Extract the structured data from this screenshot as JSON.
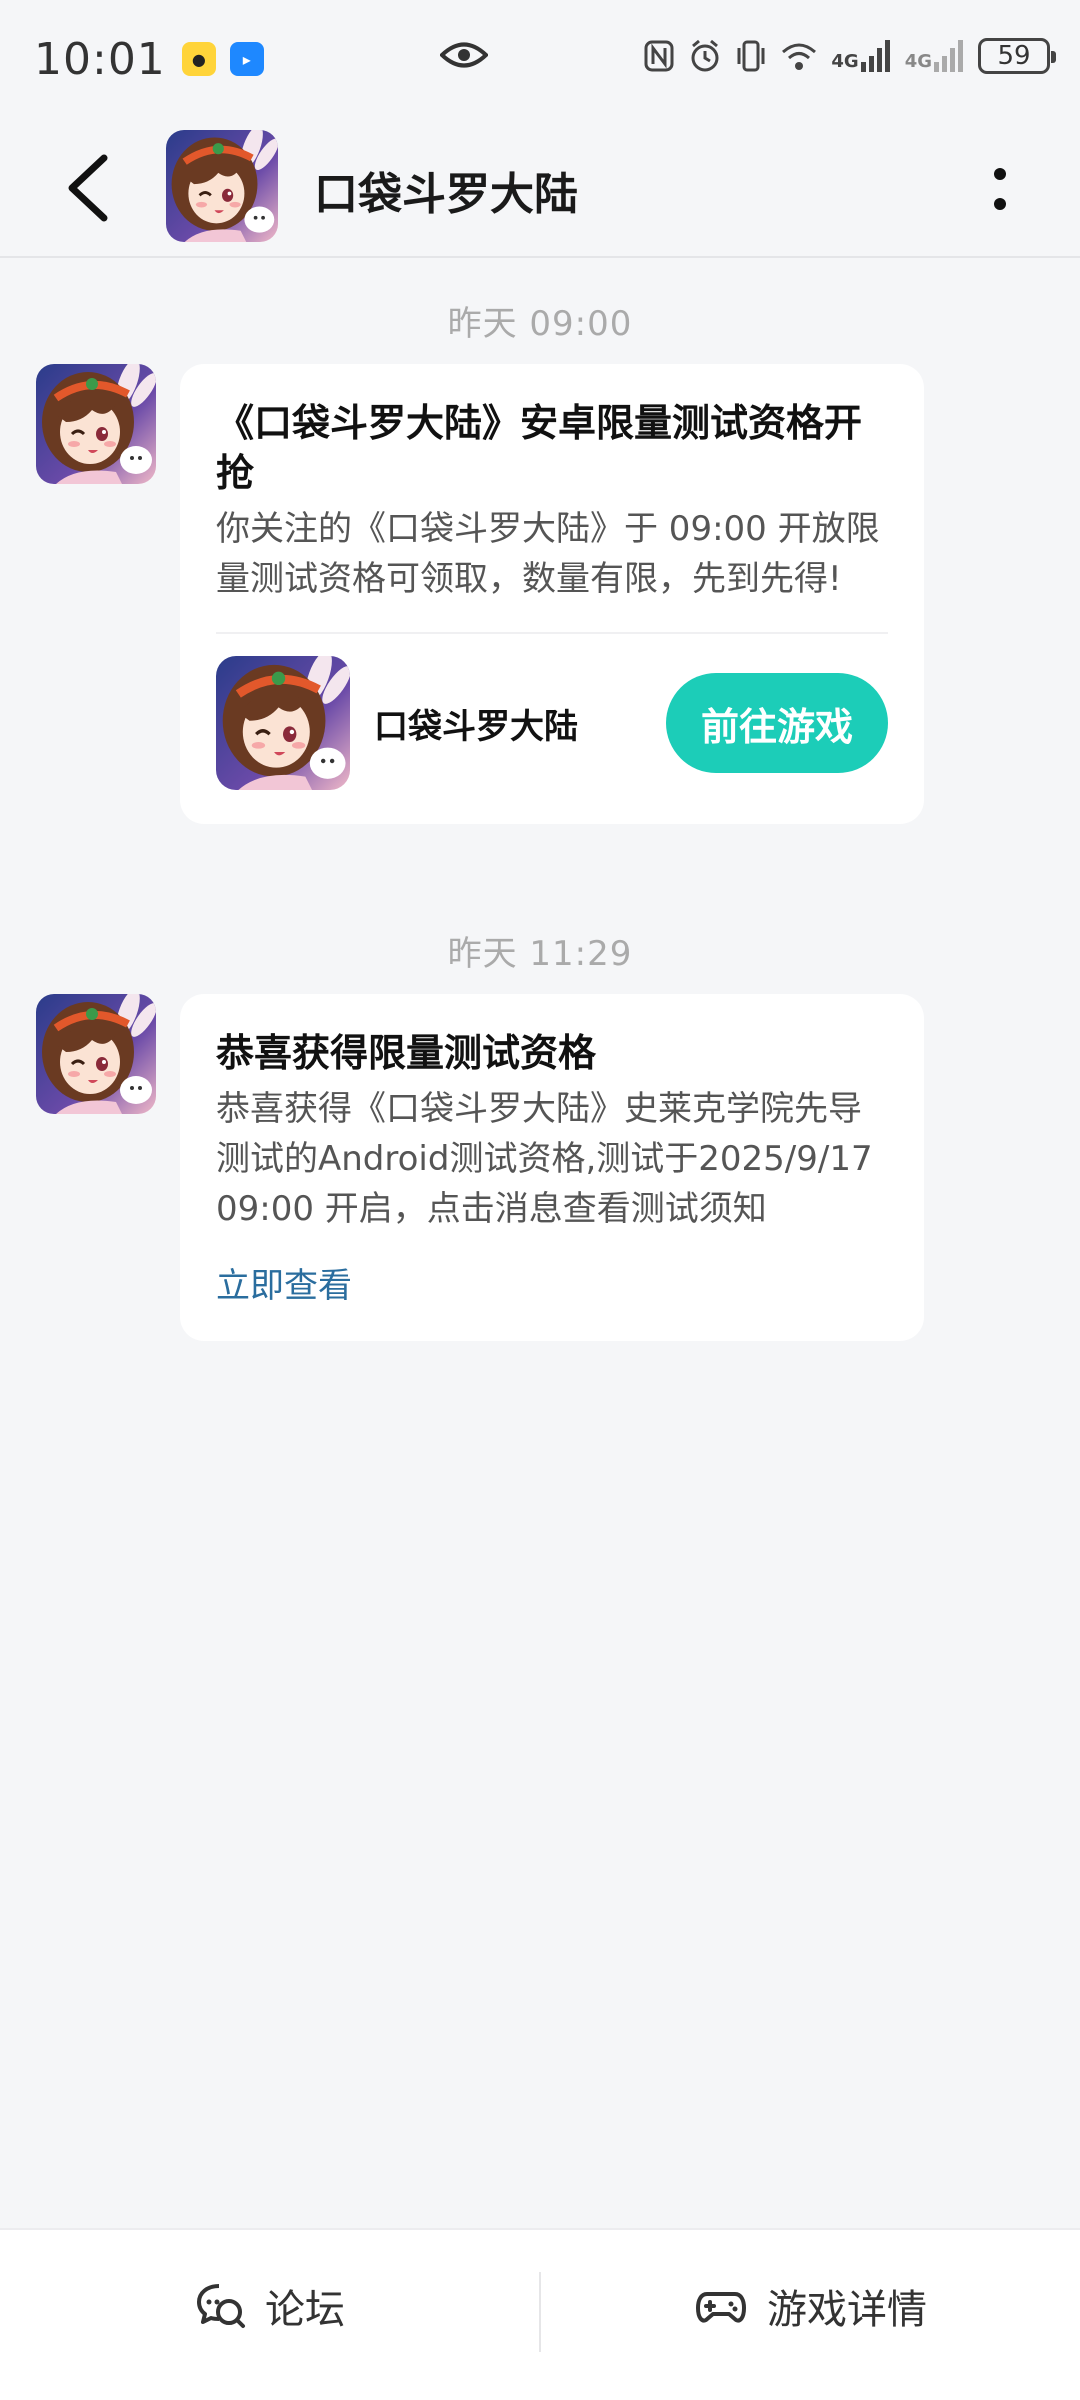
{
  "status_bar": {
    "time": "10:01",
    "battery": "59",
    "net1": "4G",
    "net2": "4G"
  },
  "header": {
    "title": "口袋斗罗大陆"
  },
  "messages": [
    {
      "time": "昨天  09:00",
      "title": "《口袋斗罗大陆》安卓限量测试资格开抢",
      "body": "你关注的《口袋斗罗大陆》于 09:00 开放限量测试资格可领取，数量有限，先到先得!",
      "game_name": "口袋斗罗大陆",
      "button": "前往游戏"
    },
    {
      "time": "昨天  11:29",
      "title": "恭喜获得限量测试资格",
      "body": "恭喜获得《口袋斗罗大陆》史莱克学院先导测试的Android测试资格,测试于2025/9/17 09:00 开启，点击消息查看测试须知",
      "link": "立即查看"
    }
  ],
  "bottom_bar": {
    "forum": "论坛",
    "details": "游戏详情"
  },
  "colors": {
    "accent": "#1ccdb8",
    "link": "#2a6d9e",
    "background": "#f5f6f8"
  },
  "icons": [
    "back-arrow-icon",
    "more-vertical-icon",
    "forum-icon",
    "gamepad-icon",
    "eye-icon",
    "nfc-icon",
    "alarm-icon",
    "vibrate-icon",
    "wifi-icon",
    "signal-icon"
  ]
}
